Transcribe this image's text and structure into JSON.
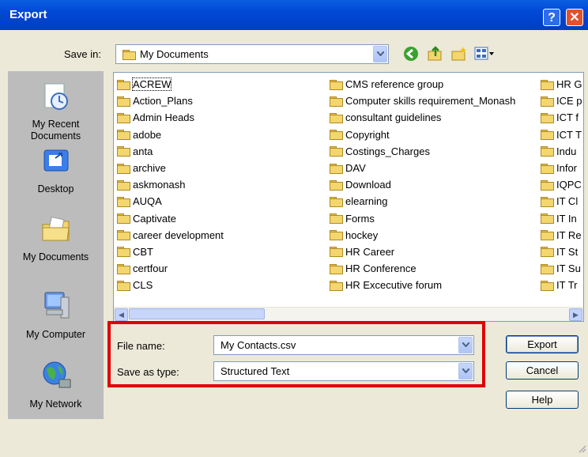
{
  "window": {
    "title": "Export",
    "help_label": "?",
    "close_label": "✕"
  },
  "save_in": {
    "label": "Save in:",
    "value": "My Documents"
  },
  "places": [
    {
      "name": "My Recent Documents",
      "line1": "My Recent",
      "line2": "Documents"
    },
    {
      "name": "Desktop",
      "line1": "Desktop"
    },
    {
      "name": "My Documents",
      "line1": "My Documents"
    },
    {
      "name": "My Computer",
      "line1": "My Computer"
    },
    {
      "name": "My Network",
      "line1": "My Network"
    }
  ],
  "files": {
    "col1": [
      "ACREW",
      "Action_Plans",
      "Admin Heads",
      "adobe",
      "anta",
      "archive",
      "askmonash",
      "AUQA",
      "Captivate",
      "career development",
      "CBT",
      "certfour",
      "CLS"
    ],
    "col2": [
      "CMS reference group",
      "Computer skills requirement_Monash",
      "consultant guidelines",
      "Copyright",
      "Costings_Charges",
      "DAV",
      "Download",
      "elearning",
      "Forms",
      "hockey",
      "HR Career",
      "HR Conference",
      "HR Excecutive forum"
    ],
    "col3": [
      "HR G",
      "ICE p",
      "ICT f",
      "ICT T",
      "Indu",
      "Infor",
      "IQPC",
      "IT Cl",
      "IT In",
      "IT Re",
      "IT St",
      "IT Su",
      "IT Tr"
    ]
  },
  "file_name": {
    "label": "File name:",
    "value": "My Contacts.csv"
  },
  "save_as_type": {
    "label": "Save as type:",
    "value": "Structured Text"
  },
  "buttons": {
    "export": "Export",
    "cancel": "Cancel",
    "help": "Help"
  },
  "colors": {
    "title_bar": "#0048d6",
    "highlight_box": "#e00000",
    "dialog_bg": "#ece9d8"
  }
}
